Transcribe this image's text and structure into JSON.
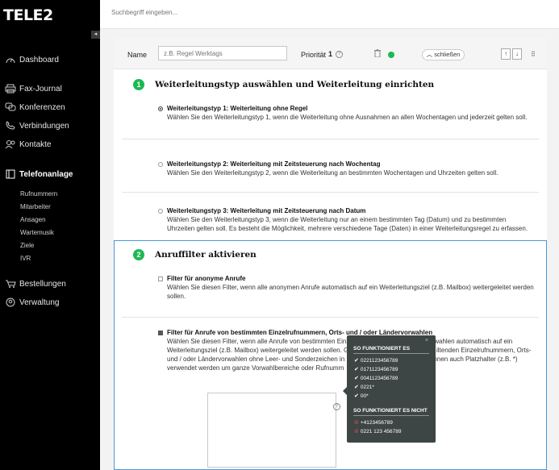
{
  "brand": {
    "logo": "TELE2"
  },
  "search": {
    "placeholder": "Suchbegriff eingeben..."
  },
  "sidebar": {
    "items": [
      {
        "label": "Dashboard",
        "icon": "gauge-icon"
      },
      {
        "label": "Fax-Journal",
        "icon": "printer-icon"
      },
      {
        "label": "Konferenzen",
        "icon": "chat-icon"
      },
      {
        "label": "Verbindungen",
        "icon": "phone-icon"
      },
      {
        "label": "Kontakte",
        "icon": "contacts-icon"
      },
      {
        "label": "Telefonanlage",
        "icon": "pbx-icon",
        "active": true
      },
      {
        "label": "Bestellungen",
        "icon": "cart-icon"
      },
      {
        "label": "Verwaltung",
        "icon": "user-icon"
      }
    ],
    "subitems": [
      "Rufnummern",
      "Mitarbeiter",
      "Ansagen",
      "Wartemusik",
      "Ziele",
      "IVR"
    ]
  },
  "rule": {
    "name_label": "Name",
    "name_placeholder": "z.B. Regel Werktags",
    "priority_label": "Priorität",
    "priority_value": "1",
    "close_label": "schließen",
    "status_color": "#1db954"
  },
  "section1": {
    "number": "1",
    "title": "Weiterleitungstyp auswählen und Weiterleitung einrichten",
    "options": [
      {
        "title": "Weiterleitungstyp 1: Weiterleitung ohne Regel",
        "text": "Wählen Sie den Weiterleitungstyp 1, wenn die Weiterleitung ohne Ausnahmen an allen Wochentagen und jederzeit gelten soll.",
        "selected": true
      },
      {
        "title": "Weiterleitungstyp 2: Weiterleitung mit Zeitsteuerung nach Wochentag",
        "text": "Wählen Sie den Weiterleitungstyp 2, wenn die Weiterleitung an bestimmten Wochentagen und Uhrzeiten gelten soll.",
        "selected": false
      },
      {
        "title": "Weiterleitungstyp 3: Weiterleitung mit Zeitsteuerung nach Datum",
        "text1": "Wählen Sie den Weiterleitungstyp 3, wenn die Weiterleitung nur an einem bestimmten Tag (Datum) und zu bestimmten",
        "text2": "Uhrzeiten gelten soll. Es besteht die Möglichkeit, mehrere verschiedene Tage (Daten) in einer Weiterleitungsregel zu erfassen.",
        "selected": false
      }
    ]
  },
  "section2": {
    "number": "2",
    "title": "Anruffilter aktivieren",
    "filter1": {
      "title": "Filter für anonyme Anrufe",
      "text1": "Wählen Sie diesen Filter, wenn alle anonymen Anrufe automatisch auf ein Weiterleitungsziel (z.B. Mailbox) weitergeleitet werden",
      "text2": "sollen.",
      "checked": false
    },
    "filter2": {
      "title": "Filter für Anrufe von bestimmten Einzelrufnummern, Orts- und / oder Ländervorwahlen",
      "line1": "Wählen Sie diesen Filter, wenn alle Anrufe von bestimmten Einz",
      "line1b": "ervorwahlen automatisch auf ein",
      "line2": "Weiterleitungsziel (z.B. Mailbox) weitergeleitet werden sollen. G",
      "line2b": "iltenden Einzelrufnummern, Orts-",
      "line3": "und / oder Ländervorwahlen ohne Leer- und Sonderzeichen in",
      "line3b": "können auch Platzhalter (z.B. *)",
      "line4": "verwendet werden um ganze Vorwahlbereiche oder Rufnumm",
      "checked": true
    }
  },
  "tooltip": {
    "works_title": "SO FUNKTIONIERT ES",
    "works": [
      "0221123456789",
      "0171123456789",
      "0041123456789",
      "0221*",
      "00*"
    ],
    "fails_title": "SO FUNKTIONIERT ES NICHT",
    "fails": [
      "+4123456789",
      "0221 123 456789"
    ],
    "close": "×"
  }
}
